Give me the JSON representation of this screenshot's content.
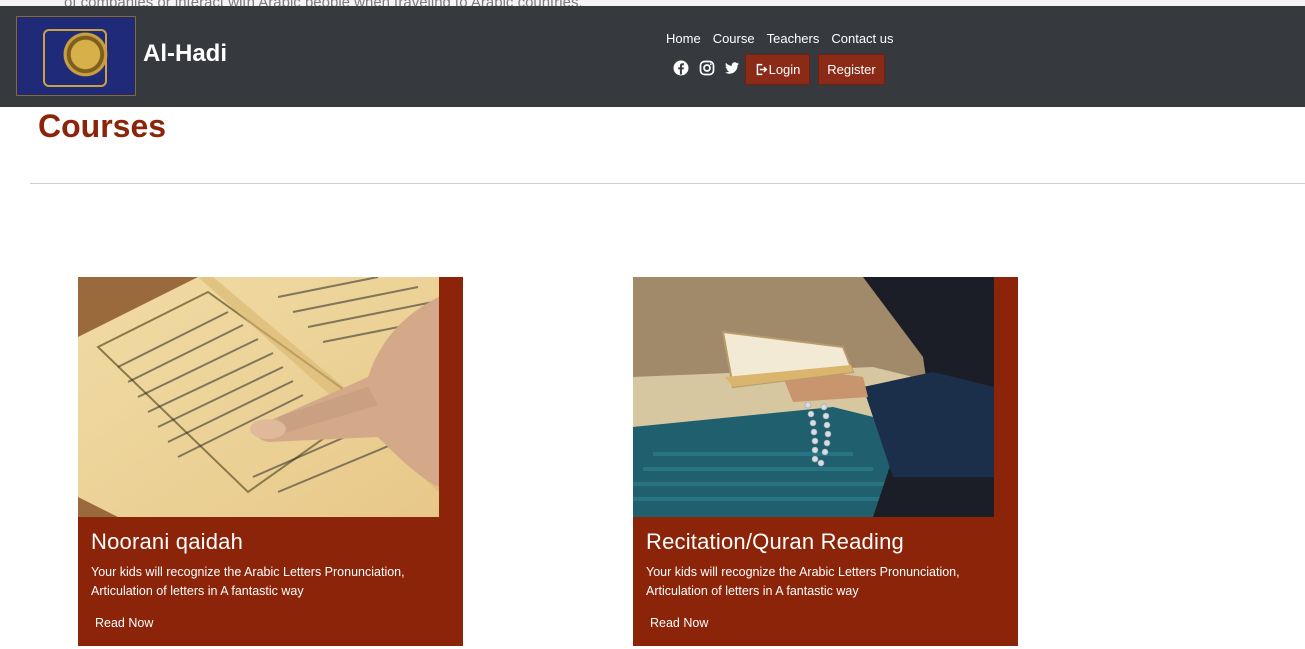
{
  "background_text": "of companies or interact with Arabic people when traveling to Arabic countries.",
  "brand": {
    "name": "Al-Hadi"
  },
  "nav": {
    "links": [
      "Home",
      "Course",
      "Teachers",
      "Contact us"
    ],
    "login_label": "Login",
    "register_label": "Register"
  },
  "page": {
    "title": "Courses"
  },
  "courses": [
    {
      "title": "Noorani qaidah",
      "description": "Your kids will recognize the Arabic Letters Pronunciation, Articulation of letters in A fantastic way",
      "link": "Read Now"
    },
    {
      "title": "Recitation/Quran Reading",
      "description": "Your kids will recognize the Arabic Letters Pronunciation, Articulation of letters in A fantastic way",
      "link": "Read Now"
    }
  ],
  "colors": {
    "navbar": "#363a3e",
    "accent": "#8b2409",
    "button": "#8b2a17"
  }
}
